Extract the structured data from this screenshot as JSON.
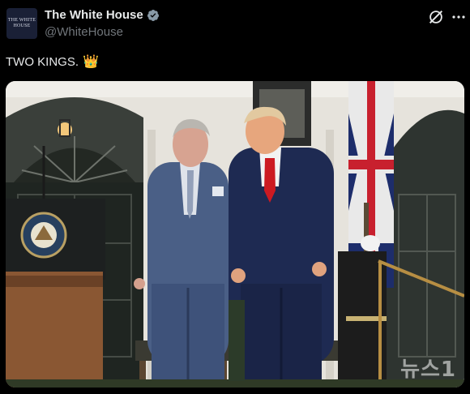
{
  "post": {
    "avatar_text": "THE WHITE HOUSE",
    "display_name": "The White House",
    "handle": "@WhiteHouse",
    "text": "TWO KINGS.",
    "emoji": "👑",
    "verified_badge_color": "#8899a6"
  },
  "icons": {
    "verified": "verified-badge-icon",
    "grok": "grok-icon",
    "more": "more-icon"
  },
  "media": {
    "watermark": "뉴스1"
  }
}
